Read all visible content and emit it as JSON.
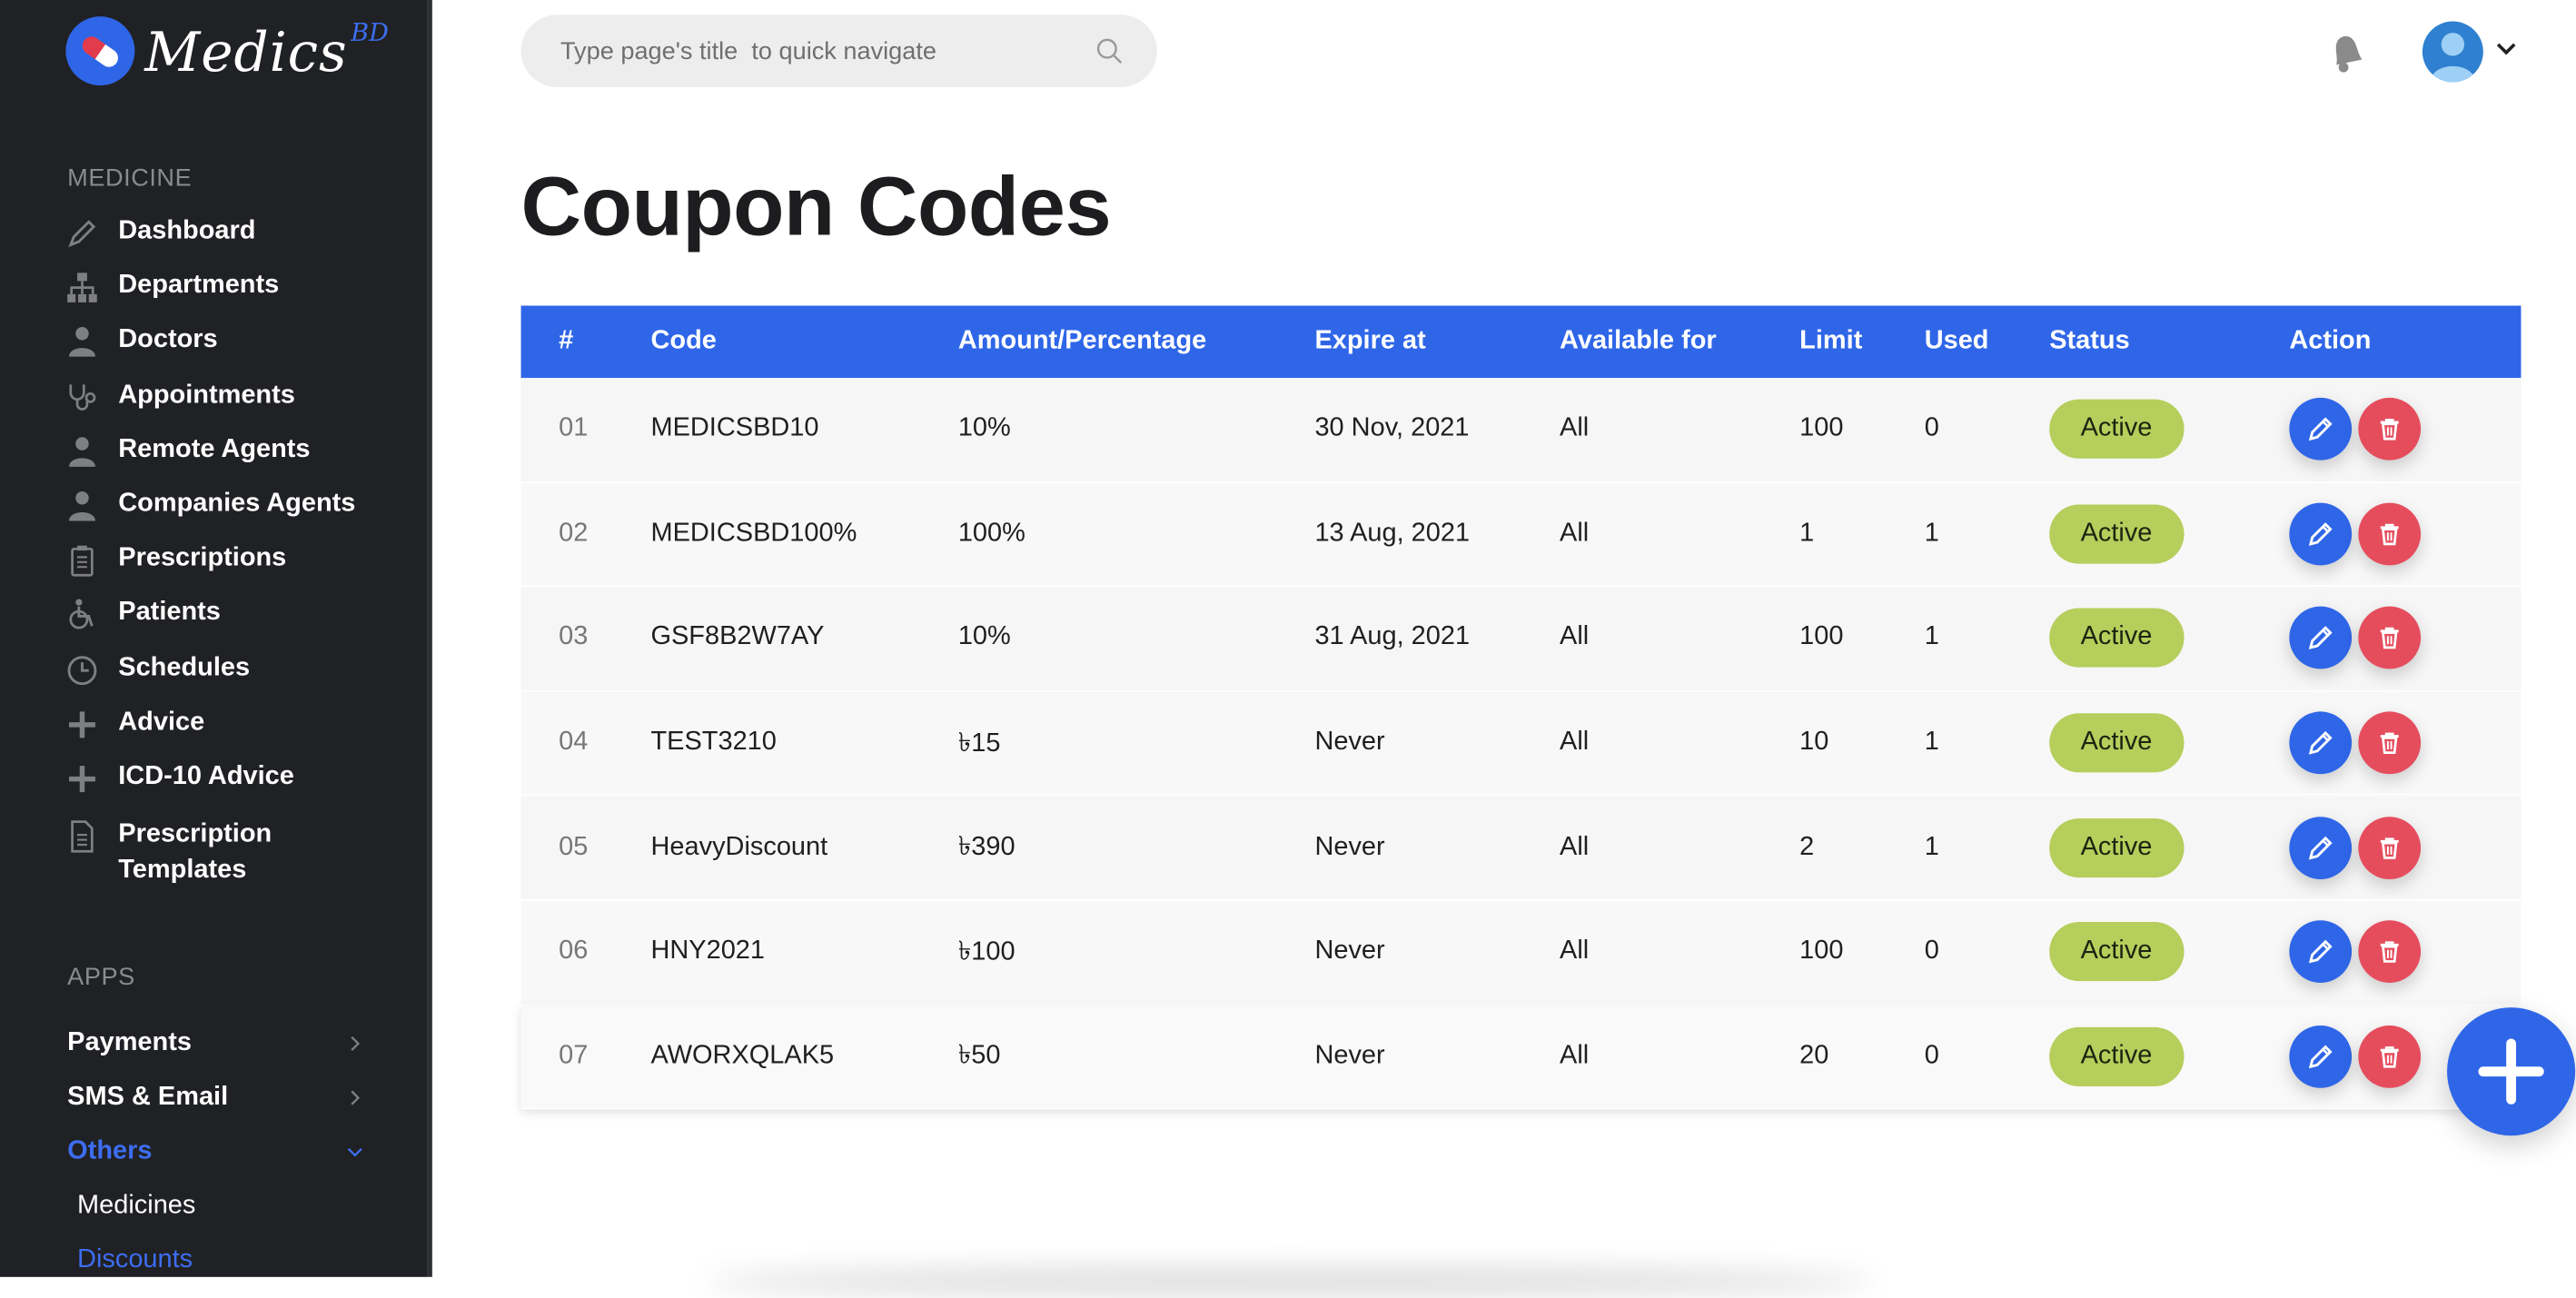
{
  "brand": {
    "name": "Medics",
    "suffix": "BD"
  },
  "sidebar": {
    "sections": {
      "medicine": "MEDICINE",
      "apps": "APPS"
    },
    "items": [
      {
        "label": "Dashboard",
        "icon": "pen-icon"
      },
      {
        "label": "Departments",
        "icon": "sitemap-icon"
      },
      {
        "label": "Doctors",
        "icon": "user-md-icon"
      },
      {
        "label": "Appointments",
        "icon": "stethoscope-icon"
      },
      {
        "label": "Remote Agents",
        "icon": "user-md-icon"
      },
      {
        "label": "Companies Agents",
        "icon": "user-md-icon"
      },
      {
        "label": "Prescriptions",
        "icon": "clipboard-icon"
      },
      {
        "label": "Patients",
        "icon": "wheelchair-icon"
      },
      {
        "label": "Schedules",
        "icon": "clock-icon"
      },
      {
        "label": "Advice",
        "icon": "plus-icon"
      },
      {
        "label": "ICD-10 Advice",
        "icon": "plus-icon"
      },
      {
        "label": "Prescription Templates",
        "icon": "file-icon"
      }
    ],
    "apps": [
      {
        "label": "Payments",
        "state": "collapsed"
      },
      {
        "label": "SMS & Email",
        "state": "collapsed"
      },
      {
        "label": "Others",
        "state": "expanded"
      }
    ],
    "others_sub": [
      {
        "label": "Medicines"
      },
      {
        "label": "Discounts"
      }
    ]
  },
  "topbar": {
    "search_placeholder": "Type page's title  to quick navigate"
  },
  "page": {
    "title": "Coupon Codes"
  },
  "table": {
    "headers": [
      "#",
      "Code",
      "Amount/Percentage",
      "Expire at",
      "Available for",
      "Limit",
      "Used",
      "Status",
      "Action"
    ],
    "rows": [
      {
        "num": "01",
        "code": "MEDICSBD10",
        "amount": "10%",
        "expire": "30 Nov, 2021",
        "available": "All",
        "limit": "100",
        "used": "0",
        "status": "Active"
      },
      {
        "num": "02",
        "code": "MEDICSBD100%",
        "amount": "100%",
        "expire": "13 Aug, 2021",
        "available": "All",
        "limit": "1",
        "used": "1",
        "status": "Active"
      },
      {
        "num": "03",
        "code": "GSF8B2W7AY",
        "amount": "10%",
        "expire": "31 Aug, 2021",
        "available": "All",
        "limit": "100",
        "used": "1",
        "status": "Active"
      },
      {
        "num": "04",
        "code": "TEST3210",
        "amount": "৳15",
        "expire": "Never",
        "available": "All",
        "limit": "10",
        "used": "1",
        "status": "Active"
      },
      {
        "num": "05",
        "code": "HeavyDiscount",
        "amount": "৳390",
        "expire": "Never",
        "available": "All",
        "limit": "2",
        "used": "1",
        "status": "Active"
      },
      {
        "num": "06",
        "code": "HNY2021",
        "amount": "৳100",
        "expire": "Never",
        "available": "All",
        "limit": "100",
        "used": "0",
        "status": "Active"
      },
      {
        "num": "07",
        "code": "AWORXQLAK5",
        "amount": "৳50",
        "expire": "Never",
        "available": "All",
        "limit": "20",
        "used": "0",
        "status": "Active"
      }
    ]
  },
  "colors": {
    "accent": "#2f66e8",
    "sidebar_bg": "#202124",
    "active_badge": "#b6ce5c",
    "delete": "#e54d5d"
  }
}
